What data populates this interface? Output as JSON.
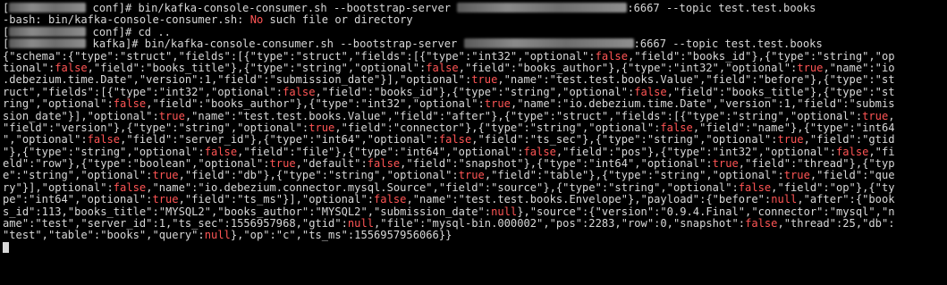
{
  "terminal": {
    "lines": [
      [
        {
          "t": "[",
          "c": ""
        },
        {
          "t": "",
          "c": "blur",
          "w": 86
        },
        {
          "t": " conf]# bin/kafka-console-consumer.sh --bootstrap-server ",
          "c": ""
        },
        {
          "t": "",
          "c": "blur",
          "w": 190
        },
        {
          "t": ":6667 --topic test.test.books",
          "c": ""
        }
      ],
      [
        {
          "t": "-bash: bin/kafka-console-consumer.sh: ",
          "c": ""
        },
        {
          "t": "No",
          "c": "red"
        },
        {
          "t": " such file or directory",
          "c": ""
        }
      ],
      [
        {
          "t": "[",
          "c": ""
        },
        {
          "t": "",
          "c": "blur",
          "w": 86
        },
        {
          "t": " conf]# cd ..",
          "c": ""
        }
      ],
      [
        {
          "t": "[",
          "c": ""
        },
        {
          "t": "",
          "c": "blur",
          "w": 86
        },
        {
          "t": " kafka]# bin/kafka-console-consumer.sh --bootstrap-server ",
          "c": ""
        },
        {
          "t": "",
          "c": "blur",
          "w": 190
        },
        {
          "t": ":6667 --topic test.test.books",
          "c": ""
        }
      ],
      [
        {
          "t": "{\"schema\":{\"type\":\"struct\",\"fields\":[{\"type\":\"struct\",\"fields\":[{\"type\":\"int32\",\"optional\":",
          "c": ""
        },
        {
          "t": "false",
          "c": "red"
        },
        {
          "t": ",\"field\":\"books_id\"},{\"type\":\"string\",\"op",
          "c": ""
        }
      ],
      [
        {
          "t": "tional\":",
          "c": ""
        },
        {
          "t": "false",
          "c": "red"
        },
        {
          "t": ",\"field\":\"books_title\"},{\"type\":\"string\",\"optional\":",
          "c": ""
        },
        {
          "t": "false",
          "c": "red"
        },
        {
          "t": ",\"field\":\"books_author\"},{\"type\":\"int32\",\"optional\":",
          "c": ""
        },
        {
          "t": "true",
          "c": "red"
        },
        {
          "t": ",\"name\":\"io",
          "c": ""
        }
      ],
      [
        {
          "t": ".debezium.time.Date\",\"version\":1,\"field\":\"submission_date\"}],\"optional\":",
          "c": ""
        },
        {
          "t": "true",
          "c": "red"
        },
        {
          "t": ",\"name\":\"test.test.books.Value\",\"field\":\"before\"},{\"type\":\"st",
          "c": ""
        }
      ],
      [
        {
          "t": "ruct\",\"fields\":[{\"type\":\"int32\",\"optional\":",
          "c": ""
        },
        {
          "t": "false",
          "c": "red"
        },
        {
          "t": ",\"field\":\"books_id\"},{\"type\":\"string\",\"optional\":",
          "c": ""
        },
        {
          "t": "false",
          "c": "red"
        },
        {
          "t": ",\"field\":\"books_title\"},{\"type\":\"st",
          "c": ""
        }
      ],
      [
        {
          "t": "ring\",\"optional\":",
          "c": ""
        },
        {
          "t": "false",
          "c": "red"
        },
        {
          "t": ",\"field\":\"books_author\"},{\"type\":\"int32\",\"optional\":",
          "c": ""
        },
        {
          "t": "true",
          "c": "red"
        },
        {
          "t": ",\"name\":\"io.debezium.time.Date\",\"version\":1,\"field\":\"submis",
          "c": ""
        }
      ],
      [
        {
          "t": "sion_date\"}],\"optional\":",
          "c": ""
        },
        {
          "t": "true",
          "c": "red"
        },
        {
          "t": ",\"name\":\"test.test.books.Value\",\"field\":\"after\"},{\"type\":\"struct\",\"fields\":[{\"type\":\"string\",\"optional\":",
          "c": ""
        },
        {
          "t": "true",
          "c": "red"
        },
        {
          "t": ",",
          "c": ""
        }
      ],
      [
        {
          "t": "\"field\":\"version\"},{\"type\":\"string\",\"optional\":",
          "c": ""
        },
        {
          "t": "true",
          "c": "red"
        },
        {
          "t": ",\"field\":\"connector\"},{\"type\":\"string\",\"optional\":",
          "c": ""
        },
        {
          "t": "false",
          "c": "red"
        },
        {
          "t": ",\"field\":\"name\"},{\"type\":\"int64",
          "c": ""
        }
      ],
      [
        {
          "t": "\",\"optional\":",
          "c": ""
        },
        {
          "t": "false",
          "c": "red"
        },
        {
          "t": ",\"field\":\"server_id\"},{\"type\":\"int64\",\"optional\":",
          "c": ""
        },
        {
          "t": "false",
          "c": "red"
        },
        {
          "t": ",\"field\":\"ts_sec\"},{\"type\":\"string\",\"optional\":",
          "c": ""
        },
        {
          "t": "true",
          "c": "red"
        },
        {
          "t": ",\"field\":\"gtid",
          "c": ""
        }
      ],
      [
        {
          "t": "\"},{\"type\":\"string\",\"optional\":",
          "c": ""
        },
        {
          "t": "false",
          "c": "red"
        },
        {
          "t": ",\"field\":\"file\"},{\"type\":\"int64\",\"optional\":",
          "c": ""
        },
        {
          "t": "false",
          "c": "red"
        },
        {
          "t": ",\"field\":\"pos\"},{\"type\":\"int32\",\"optional\":",
          "c": ""
        },
        {
          "t": "false",
          "c": "red"
        },
        {
          "t": ",\"fi",
          "c": ""
        }
      ],
      [
        {
          "t": "eld\":\"row\"},{\"type\":\"boolean\",\"optional\":",
          "c": ""
        },
        {
          "t": "true",
          "c": "red"
        },
        {
          "t": ",\"default\":",
          "c": ""
        },
        {
          "t": "false",
          "c": "red"
        },
        {
          "t": ",\"field\":\"snapshot\"},{\"type\":\"int64\",\"optional\":",
          "c": ""
        },
        {
          "t": "true",
          "c": "red"
        },
        {
          "t": ",\"field\":\"thread\"},{\"typ",
          "c": ""
        }
      ],
      [
        {
          "t": "e\":\"string\",\"optional\":",
          "c": ""
        },
        {
          "t": "true",
          "c": "red"
        },
        {
          "t": ",\"field\":\"db\"},{\"type\":\"string\",\"optional\":",
          "c": ""
        },
        {
          "t": "true",
          "c": "red"
        },
        {
          "t": ",\"field\":\"table\"},{\"type\":\"string\",\"optional\":",
          "c": ""
        },
        {
          "t": "true",
          "c": "red"
        },
        {
          "t": ",\"field\":\"que",
          "c": ""
        }
      ],
      [
        {
          "t": "ry\"}],\"optional\":",
          "c": ""
        },
        {
          "t": "false",
          "c": "red"
        },
        {
          "t": ",\"name\":\"io.debezium.connector.mysql.Source\",\"field\":\"source\"},{\"type\":\"string\",\"optional\":",
          "c": ""
        },
        {
          "t": "false",
          "c": "red"
        },
        {
          "t": ",\"field\":\"op\"},{\"ty",
          "c": ""
        }
      ],
      [
        {
          "t": "pe\":\"int64\",\"optional\":",
          "c": ""
        },
        {
          "t": "true",
          "c": "red"
        },
        {
          "t": ",\"field\":\"ts_ms\"}],\"optional\":",
          "c": ""
        },
        {
          "t": "false",
          "c": "red"
        },
        {
          "t": ",\"name\":\"test.test.books.Envelope\"},\"payload\":{\"before\":",
          "c": ""
        },
        {
          "t": "null",
          "c": "red"
        },
        {
          "t": ",\"after\":{\"book",
          "c": ""
        }
      ],
      [
        {
          "t": "s_id\":113,\"books_title\":\"MYSQL2\",\"books_author\":\"MYSQL2\",\"submission_date\":",
          "c": ""
        },
        {
          "t": "null",
          "c": "red"
        },
        {
          "t": "},\"source\":{\"version\":\"0.9.4.Final\",\"connector\":\"mysql\",\"n",
          "c": ""
        }
      ],
      [
        {
          "t": "ame\":\"test\",\"server_id\":1,\"ts_sec\":1556957968,\"gtid\":",
          "c": ""
        },
        {
          "t": "null",
          "c": "red"
        },
        {
          "t": ",\"file\":\"mysql-bin.000002\",\"pos\":2283,\"row\":0,\"snapshot\":",
          "c": ""
        },
        {
          "t": "false",
          "c": "red"
        },
        {
          "t": ",\"thread\":25,\"db\":",
          "c": ""
        }
      ],
      [
        {
          "t": "\"test\",\"table\":\"books\",\"query\":",
          "c": ""
        },
        {
          "t": "null",
          "c": "red"
        },
        {
          "t": "},\"op\":\"c\",\"ts_ms\":1556957956066}}",
          "c": ""
        }
      ]
    ]
  },
  "colors": {
    "background": "#000000",
    "foreground": "#d8d8d8",
    "keyword": "#ff5555"
  }
}
